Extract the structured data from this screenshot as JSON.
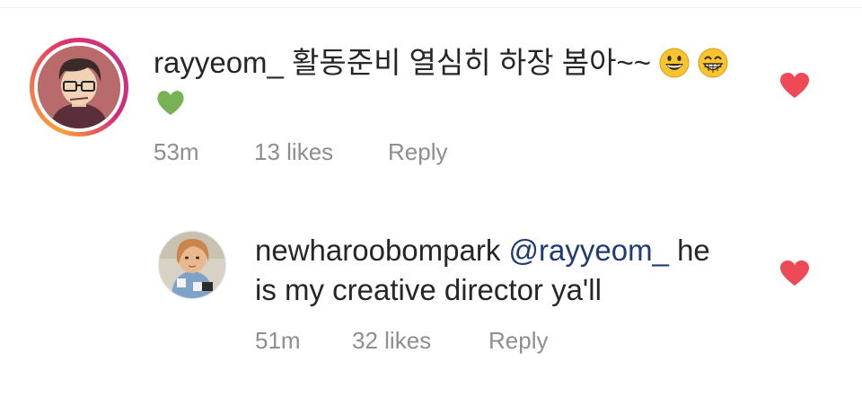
{
  "comments": [
    {
      "username": "rayyeom_",
      "text": "활동준비 열심히 하장 봄아~~",
      "emojis": [
        "grinning-face",
        "grinning-face-with-smiling-eyes",
        "green-heart"
      ],
      "time": "53m",
      "likes": "13 likes",
      "reply_label": "Reply"
    },
    {
      "username": "newharoobompark",
      "mention": "@rayyeom_",
      "text_line1_tail": " he",
      "text_line2": "is my creative director ya'll",
      "time": "51m",
      "likes": "32 likes",
      "reply_label": "Reply"
    }
  ],
  "colors": {
    "heart": "#ed4956",
    "meta": "#8e8e8e",
    "mention": "#1f3b73",
    "ring_start": "#f9a13a",
    "ring_end": "#c13584"
  }
}
